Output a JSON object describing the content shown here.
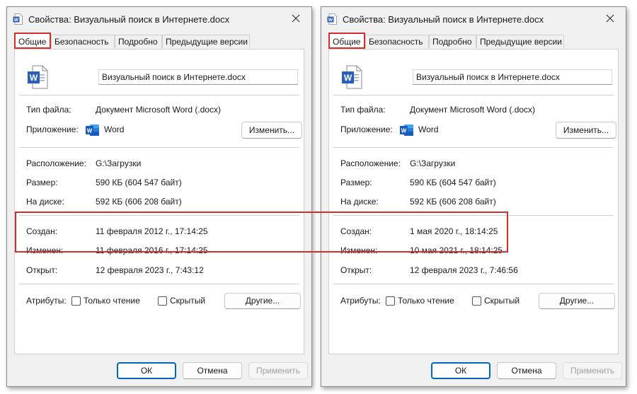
{
  "accent_highlight_color": "#d32f2f",
  "word_icon_color": "#2b5eb8",
  "dialogs": [
    {
      "title": "Свойства: Визуальный поиск в Интернете.docx",
      "tabs": [
        "Общие",
        "Безопасность",
        "Подробно",
        "Предыдущие версии"
      ],
      "active_tab": "Общие",
      "file_name": "Визуальный поиск в Интернете.docx",
      "type_label": "Тип файла:",
      "type_value": "Документ Microsoft Word (.docx)",
      "app_label": "Приложение:",
      "app_value": "Word",
      "change_button": "Изменить...",
      "location_label": "Расположение:",
      "location_value": "G:\\Загрузки",
      "size_label": "Размер:",
      "size_value": "590 КБ (604 547 байт)",
      "disk_label": "На диске:",
      "disk_value": "592 КБ (606 208 байт)",
      "created_label": "Создан:",
      "created_value": "11 февраля 2012 г., 17:14:25",
      "modified_label": "Изменен:",
      "modified_value": "11 февраля 2016 г., 17:14:25",
      "opened_label": "Открыт:",
      "opened_value": "12 февраля 2023 г., 7:43:12",
      "attributes_label": "Атрибуты:",
      "readonly_label": "Только чтение",
      "hidden_label": "Скрытый",
      "other_button": "Другие...",
      "ok_button": "ОК",
      "cancel_button": "Отмена",
      "apply_button": "Применить"
    },
    {
      "title": "Свойства: Визуальный поиск в Интернете.docx",
      "tabs": [
        "Общие",
        "Безопасность",
        "Подробно",
        "Предыдущие версии"
      ],
      "active_tab": "Общие",
      "file_name": "Визуальный поиск в Интернете.docx",
      "type_label": "Тип файла:",
      "type_value": "Документ Microsoft Word (.docx)",
      "app_label": "Приложение:",
      "app_value": "Word",
      "change_button": "Изменить...",
      "location_label": "Расположение:",
      "location_value": "G:\\Загрузки",
      "size_label": "Размер:",
      "size_value": "590 КБ (604 547 байт)",
      "disk_label": "На диске:",
      "disk_value": "592 КБ (606 208 байт)",
      "created_label": "Создан:",
      "created_value": "1 мая 2020 г., 18:14:25",
      "modified_label": "Изменен:",
      "modified_value": "10 мая 2021 г., 18:14:25",
      "opened_label": "Открыт:",
      "opened_value": "12 февраля 2023 г., 7:46:56",
      "attributes_label": "Атрибуты:",
      "readonly_label": "Только чтение",
      "hidden_label": "Скрытый",
      "other_button": "Другие...",
      "ok_button": "ОК",
      "cancel_button": "Отмена",
      "apply_button": "Применить"
    }
  ]
}
